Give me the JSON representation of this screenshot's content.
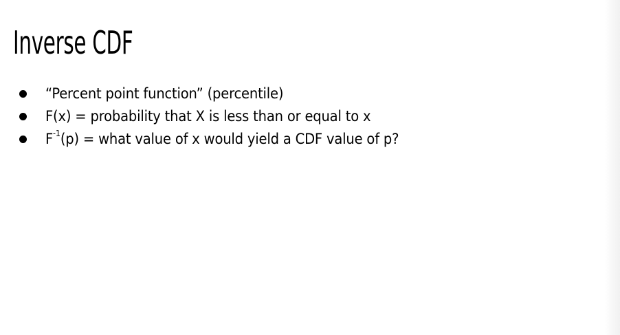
{
  "slide": {
    "title": "Inverse CDF",
    "bullets": [
      {
        "text": "“Percent point function” (percentile)"
      },
      {
        "text": "F(x) = probability that X is less than or equal to x"
      },
      {
        "prefix": "F",
        "superscript": "-1",
        "text": "(p) = what value of x would yield a CDF value of p?"
      }
    ]
  }
}
